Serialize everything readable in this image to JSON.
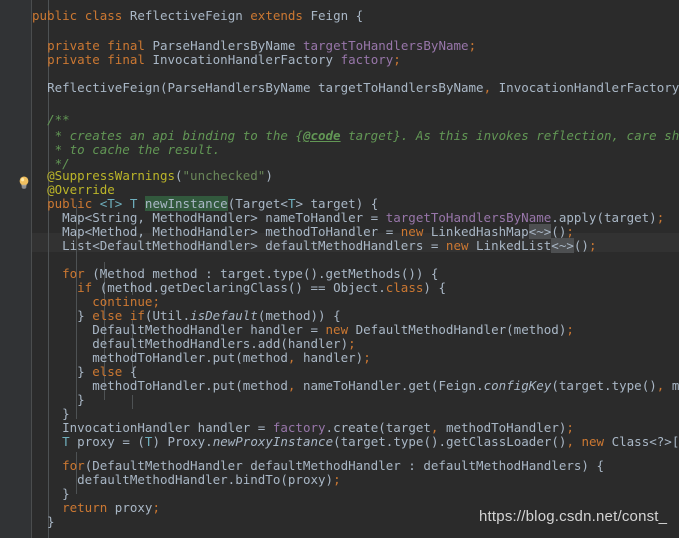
{
  "editor": {
    "theme": "darcula",
    "background": "#2b2b2b",
    "gutter_background": "#313335",
    "text_color": "#a9b7c6",
    "caret_line_color": "#323232",
    "usage_highlight_color": "#32593d",
    "language": "java"
  },
  "gutter": {
    "bulb_icon": "lightbulb-intention-icon",
    "fold_expand_icon": "fold-expand-icon",
    "fold_collapse_icon": "fold-collapse-icon"
  },
  "watermark": {
    "text": "https://blog.csdn.net/const_"
  },
  "code": {
    "lines": [
      "public class ReflectiveFeign extends Feign {",
      "",
      "  private final ParseHandlersByName targetToHandlersByName;",
      "  private final InvocationHandlerFactory factory;",
      "",
      "  ReflectiveFeign(ParseHandlersByName targetToHandlersByName, InvocationHandlerFactory factory)",
      "",
      "  /**",
      "   * creates an api binding to the {@code target}. As this invokes reflection, care should be t",
      "   * to cache the result.",
      "   */",
      "  @SuppressWarnings(\"unchecked\")",
      "  @Override",
      "  public <T> T newInstance(Target<T> target) {",
      "    Map<String, MethodHandler> nameToHandler = targetToHandlersByName.apply(target);",
      "    Map<Method, MethodHandler> methodToHandler = new LinkedHashMap<~>();",
      "    List<DefaultMethodHandler> defaultMethodHandlers = new LinkedList<~>();",
      "",
      "    for (Method method : target.type().getMethods()) {",
      "      if (method.getDeclaringClass() == Object.class) {",
      "        continue;",
      "      } else if(Util.isDefault(method)) {",
      "        DefaultMethodHandler handler = new DefaultMethodHandler(method);",
      "        defaultMethodHandlers.add(handler);",
      "        methodToHandler.put(method, handler);",
      "      } else {",
      "        methodToHandler.put(method, nameToHandler.get(Feign.configKey(target.type(), method)));",
      "      }",
      "    }",
      "    InvocationHandler handler = factory.create(target, methodToHandler);",
      "    T proxy = (T) Proxy.newProxyInstance(target.type().getClassLoader(), new Class<?>[]{target.t",
      "",
      "    for(DefaultMethodHandler defaultMethodHandler : defaultMethodHandlers) {",
      "      defaultMethodHandler.bindTo(proxy);",
      "    }",
      "    return proxy;",
      "  }"
    ],
    "caret_line_index": 13,
    "highlighted_identifier": "newInstance",
    "class_name": "ReflectiveFeign",
    "superclass": "Feign",
    "fields": [
      "targetToHandlersByName",
      "factory"
    ],
    "annotations": [
      "@SuppressWarnings(\"unchecked\")",
      "@Override"
    ],
    "javadoc_tag": "@code"
  }
}
